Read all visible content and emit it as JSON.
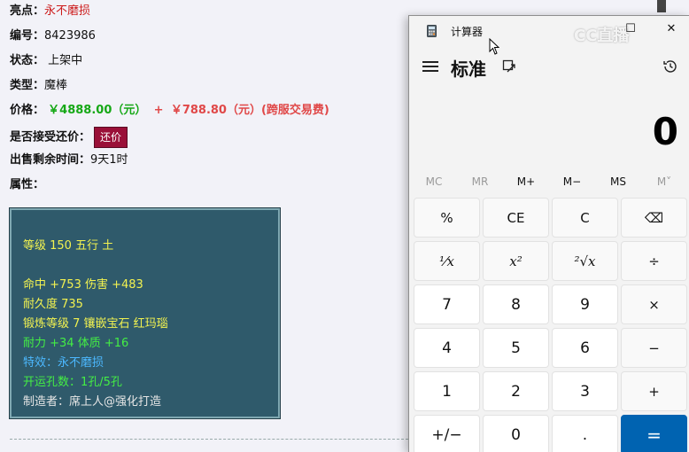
{
  "listing": {
    "highlight_label": "亮点：",
    "highlight_value": "永不磨损",
    "id_label": "编号：",
    "id_value": "8423986",
    "status_label": "状态：",
    "status_value": "上架中",
    "type_label": "类型：",
    "type_value": "魔棒",
    "price_label": "价格：",
    "price_main": "￥4888.00（元）",
    "price_plus": "+",
    "price_fee": "￥788.80（元）(跨服交易费)",
    "offer_label": "是否接受还价：",
    "offer_button": "还价",
    "remaining_label": "出售剩余时间：",
    "remaining_value": "9天1时",
    "attrs_label": "属性："
  },
  "attributes": {
    "line1": "等级 150 五行 土",
    "line2": "命中 +753 伤害 +483",
    "line3": "耐久度 735",
    "line4": "锻炼等级 7 镶嵌宝石 红玛瑙",
    "line5": "耐力 +34 体质 +16",
    "line6": "特效：永不磨损",
    "line7": "开运孔数：1孔/5孔",
    "line8": "制造者：席上人@强化打造"
  },
  "calculator": {
    "window_title": "计算器",
    "mode": "标准",
    "display": "0",
    "watermark": "CC直播",
    "memory": [
      "MC",
      "MR",
      "M+",
      "M−",
      "MS",
      "M˅"
    ],
    "keys": {
      "percent": "%",
      "ce": "CE",
      "c": "C",
      "backspace": "⌫",
      "reciprocal": "¹⁄x",
      "square": "x²",
      "sqrt": "²√x",
      "divide": "÷",
      "seven": "7",
      "eight": "8",
      "nine": "9",
      "multiply": "×",
      "four": "4",
      "five": "5",
      "six": "6",
      "minus": "−",
      "one": "1",
      "two": "2",
      "three": "3",
      "plus": "+",
      "negate": "+/−",
      "zero": "0",
      "decimal": ".",
      "equals": "="
    },
    "colors": {
      "equals_bg": "#0063b1",
      "accent": "#0063b1"
    }
  }
}
